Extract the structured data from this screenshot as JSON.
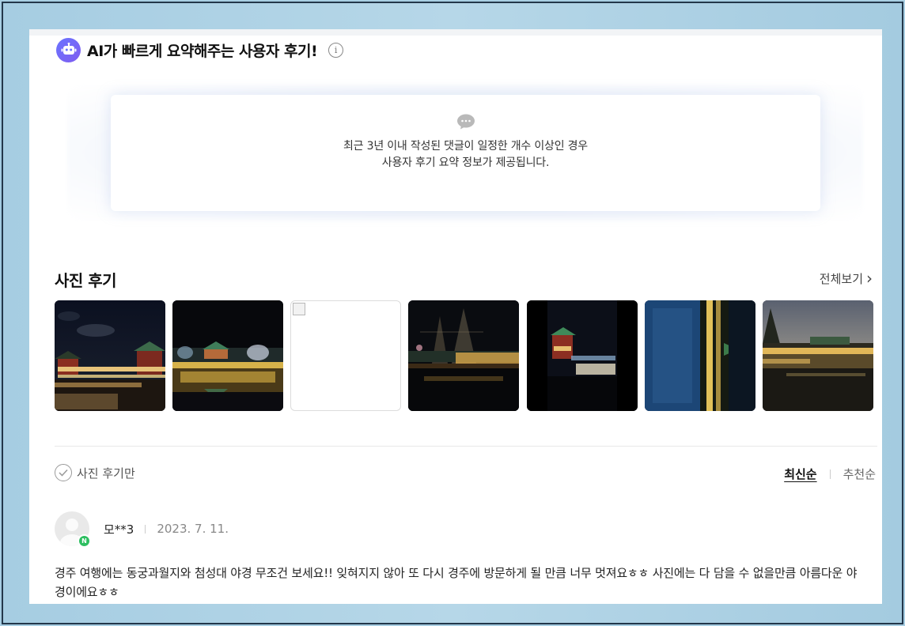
{
  "ai_summary": {
    "title": "AI가 빠르게 요약해주는 사용자 후기!",
    "info_glyph": "i",
    "message_line1": "최근 3년 이내 작성된 댓글이 일정한 개수 이상인 경우",
    "message_line2": "사용자 후기 요약 정보가 제공됩니다."
  },
  "photo_reviews": {
    "title": "사진 후기",
    "view_all": "전체보기",
    "view_all_chevron": "›",
    "photos": [
      {
        "desc": "night-palace-pavilion"
      },
      {
        "desc": "night-pond-reflection"
      },
      {
        "desc": "broken-image"
      },
      {
        "desc": "night-trees-lights"
      },
      {
        "desc": "night-pavilion-vertical"
      },
      {
        "desc": "night-rotated-lights"
      },
      {
        "desc": "dusk-pond-panorama"
      }
    ]
  },
  "filters": {
    "photo_only_label": "사진 후기만",
    "sort_latest": "최신순",
    "sort_recommended": "추천순"
  },
  "review": {
    "author": "모**3",
    "date": "2023. 7. 11.",
    "badge": "N",
    "text": "경주 여행에는 동궁과월지와 첨성대 야경 무조건 보세요!! 잊혀지지 않아 또 다시 경주에 방문하게 될 만큼 너무 멋져요ㅎㅎ 사진에는 다 담을 수 없을만큼 아름다운 야경이에요ㅎㅎ"
  },
  "colors": {
    "ai_icon": "#6a74ff",
    "badge_green": "#2dbe60",
    "frame_bg": "#a9cfe3"
  }
}
